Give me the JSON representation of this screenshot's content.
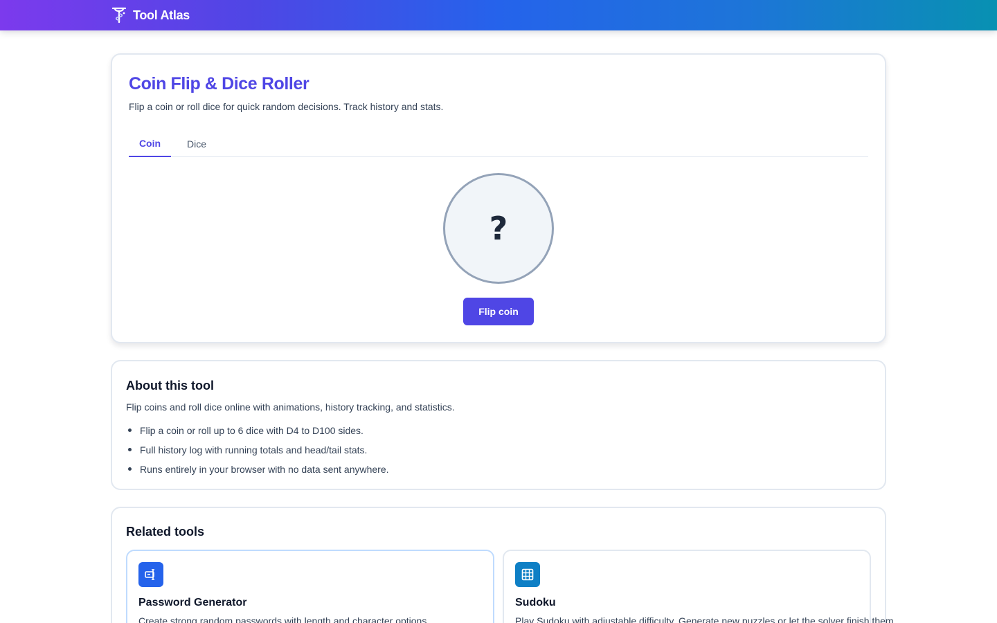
{
  "brand": {
    "name": "Tool Atlas",
    "logo_icon": "tool-atlas-logo-icon"
  },
  "header_gradient": [
    "#7c3aed",
    "#4f46e5",
    "#2563eb",
    "#0891b2"
  ],
  "accent_color": "#4f46e5",
  "tool": {
    "title": "Coin Flip & Dice Roller",
    "subtitle": "Flip a coin or roll dice for quick random decisions. Track history and stats.",
    "tabs": [
      {
        "label": "Coin",
        "active": true
      },
      {
        "label": "Dice",
        "active": false
      }
    ],
    "coin": {
      "face": "?",
      "button_label": "Flip coin"
    }
  },
  "about": {
    "heading": "About this tool",
    "intro": "Flip coins and roll dice online with animations, history tracking, and statistics.",
    "bullets": [
      "Flip a coin or roll up to 6 dice with D4 to D100 sides.",
      "Full history log with running totals and head/tail stats.",
      "Runs entirely in your browser with no data sent anywhere."
    ]
  },
  "related": {
    "heading": "Related tools",
    "tools": [
      {
        "name": "Password Generator",
        "description": "Create strong random passwords with length and character options.",
        "icon": "password-icon",
        "icon_color": "#2563eb"
      },
      {
        "name": "Sudoku",
        "description": "Play Sudoku with adjustable difficulty. Generate new puzzles or let the solver finish them.",
        "icon": "grid-icon",
        "icon_color": "#0e7fc5"
      }
    ]
  }
}
